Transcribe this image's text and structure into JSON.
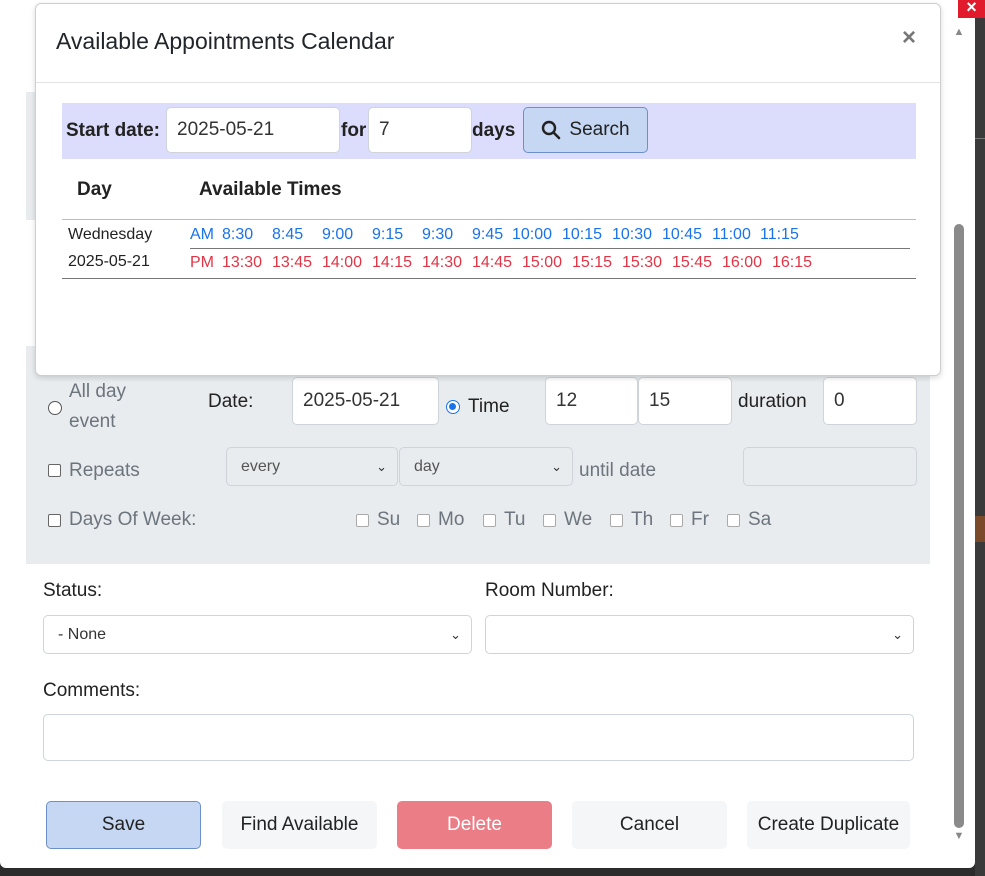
{
  "modal": {
    "title": "Available Appointments Calendar",
    "close": "×",
    "search": {
      "start_label": "Start date:",
      "start_value": "2025-05-21",
      "for_label": "for",
      "days_value": "7",
      "days_label": "days",
      "button": "Search"
    },
    "table": {
      "headers": [
        "Day",
        "Available Times"
      ],
      "rows": [
        {
          "day": "Wednesday",
          "date": "2025-05-21",
          "am_label": "AM",
          "am_times": [
            "8:30",
            "8:45",
            "9:00",
            "9:15",
            "9:30",
            "9:45",
            "10:00",
            "10:15",
            "10:30",
            "10:45",
            "11:00",
            "11:15"
          ],
          "pm_label": "PM",
          "pm_times": [
            "13:30",
            "13:45",
            "14:00",
            "14:15",
            "14:30",
            "14:45",
            "15:00",
            "15:15",
            "15:30",
            "15:45",
            "16:00",
            "16:15"
          ]
        }
      ]
    }
  },
  "form": {
    "all_day_line1": "All day",
    "all_day_line2": "event",
    "date_label": "Date:",
    "date_value": "2025-05-21",
    "time_label": "Time",
    "hour_value": "12",
    "minute_value": "15",
    "duration_label": "duration",
    "duration_value": "0",
    "repeats_label": "Repeats",
    "repeat_every": "every",
    "repeat_unit": "day",
    "until_label": "until date",
    "days_of_week_label": "Days Of Week:",
    "days": [
      "Su",
      "Mo",
      "Tu",
      "We",
      "Th",
      "Fr",
      "Sa"
    ],
    "status_label": "Status:",
    "status_value": "- None",
    "room_label": "Room Number:",
    "room_value": "",
    "comments_label": "Comments:",
    "comments_value": ""
  },
  "buttons": {
    "save": "Save",
    "find_available": "Find Available",
    "delete": "Delete",
    "cancel": "Cancel",
    "create_duplicate": "Create Duplicate"
  },
  "window_close": "×",
  "colors": {
    "am_times": "#1a73e8",
    "pm_times": "#e03546",
    "search_bar": "#dcdcfc",
    "primary_button": "#c5d7f2",
    "delete_button": "#eb7d87",
    "form_panel": "#e9ecef"
  },
  "icons": {
    "search": "magnifier-icon",
    "close": "x-icon",
    "dropdown": "chevron-down-icon"
  }
}
